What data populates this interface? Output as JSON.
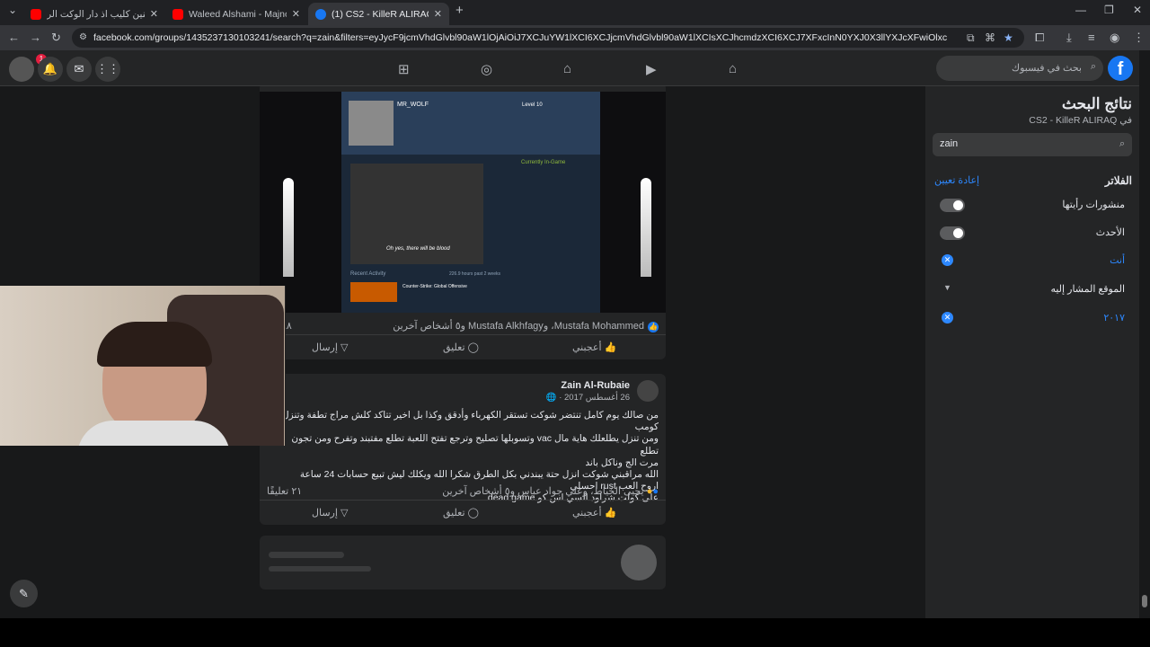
{
  "browser": {
    "tabs": [
      {
        "title": "خالد الحنين كليب اذ دار الوكت الر..."
      },
      {
        "title": "Waleed Alshami - Majnooni / ...."
      },
      {
        "title": "(1) CS2 - KilleR ALIRAQ | Faceb..."
      }
    ],
    "url": "facebook.com/groups/1435237130103241/search?q=zain&filters=eyJycF9jcmVhdGlvbl90aW1lOjAiOiJ7XCJuYW1lXCI6XCJjcmVhdGlvbl90aW1lXCIsXCJhcmdzXCI6XCJ7XFxcInN0YXJ0X3llYXJcXFwiOlxcXCIyMDE3XFxclxxFwic3RhcnRfbW..."
  },
  "fb": {
    "search_placeholder": "بحث في فيسبوك",
    "notif_count": "1",
    "brand_color": "#1877f2"
  },
  "sidebar": {
    "title": "نتائج البحث",
    "subtitle": "في CS2 - KilleR ALIRAQ",
    "query": "zain",
    "filters_label": "الفلاتر",
    "reset_label": "إعادة تعيين",
    "filters": [
      {
        "label": "منشورات رأيتها"
      },
      {
        "label": "الأحدث"
      },
      {
        "label": "أنت"
      },
      {
        "label": "الموقع المشار إليه"
      },
      {
        "label": "٢٠١٧"
      }
    ]
  },
  "post1": {
    "steam_user": "MR_WOLF",
    "steam_level": "Level 10",
    "caption": "Oh yes, there will be blood",
    "steam_status": "Currently In-Game",
    "recent_activity": "Recent Activity",
    "game": "Counter-Strike: Global Offensive",
    "hours": "226.9 hours past 2 weeks",
    "reactions": "Mustafa Mohammed، وMustafa Alkhfagy و٥ أشخاص آخرين",
    "comments_count": "٦٨",
    "like": "أعجبني",
    "comment": "تعليق",
    "send": "إرسال"
  },
  "post2": {
    "author": "Zain Al-Rubaie",
    "date": "26 أغسطس 2017",
    "lines": [
      "من صالك يوم كامل تنتضر شوكت تستقر الكهرباء وأدقق وكذا بل اخير تتاكد كلش مراج تطفة وتنزل كومب",
      "ومن تنزل يطلعلك هاية مال vac وتسوبلها تصليح وترجع تفتح اللعبة تطلع مفتبند وتفرح  ومن تجون تطلع",
      "مرت الج وناكل باند",
      "الله مراقبني شوكت انزل حتة يبندني بكل الطرق شكرا الله ويكلك ليش تبيع حسابات 24 ساعة",
      "اروح العب rust احسلي",
      "على كولت شراود السي اس كو dead game"
    ],
    "reactions": "يحيى الخياط، وعلي جواد عباس و٥ أشخاص آخرين",
    "comments": "٢١ تعليقًا",
    "like": "أعجبني",
    "comment": "تعليق",
    "send": "إرسال"
  }
}
